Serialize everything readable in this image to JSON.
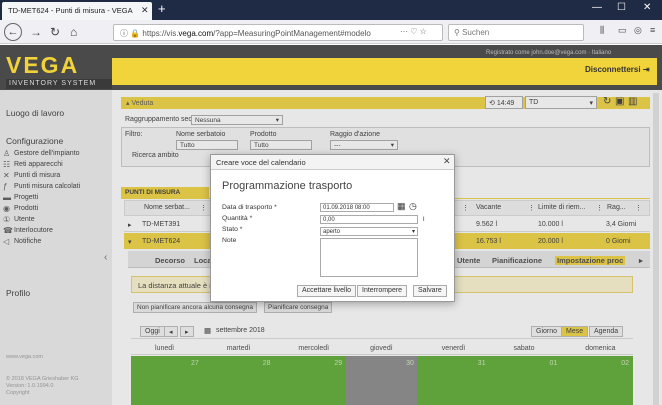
{
  "browser": {
    "tab_title": "TD-MET624 - Punti di misura - VEGA",
    "url_prefix": "https://vis.",
    "url_host": "vega.com",
    "url_rest": "/?app=MeasuringPointManagement#modelo",
    "search_placeholder": "Suchen"
  },
  "header": {
    "logo": "VEGA",
    "subtitle": "INVENTORY SYSTEM",
    "registered": "Registrato come john.doe@vega.com · Italiano",
    "logout": "Disconnettersi"
  },
  "sidebar": {
    "workplace": "Luogo di lavoro",
    "config": "Configurazione",
    "items": [
      {
        "label": "Gestore dell'impianto",
        "icon": "plant-icon"
      },
      {
        "label": "Reti apparecchi",
        "icon": "network-icon"
      },
      {
        "label": "Punti di misura",
        "icon": "tools-icon"
      },
      {
        "label": "Punti misura calcolati",
        "icon": "function-icon"
      },
      {
        "label": "Progetti",
        "icon": "folder-icon"
      },
      {
        "label": "Prodotti",
        "icon": "product-icon"
      },
      {
        "label": "Utente",
        "icon": "user-icon"
      },
      {
        "label": "Interlocutore",
        "icon": "phone-icon"
      },
      {
        "label": "Notifiche",
        "icon": "megaphone-icon"
      }
    ],
    "profile": "Profilo",
    "footer1": "www.vega.com",
    "footer2": "© 2018 VEGA Grieshaber KG",
    "footer3": "Version: 1.0.1994.0",
    "footer4": "Copyright"
  },
  "view": {
    "veduta": "Veduta",
    "time": "14:49",
    "td": "TD",
    "group_label": "Raggruppamento secondo:",
    "group_value": "Nessuna",
    "filter": "Filtro:",
    "f1": "Nome serbatoio",
    "f1v": "Tutto",
    "f2": "Prodotto",
    "f2v": "Tutto",
    "f3": "Raggio d'azione",
    "f3v": "---",
    "search": "Ricerca ambito"
  },
  "table": {
    "title": "PUNTI DI MISURA",
    "headers": [
      "Nome serbat...",
      "Vacante",
      "Limite di riem...",
      "Rag..."
    ],
    "rows": [
      {
        "name": "TD-MET391",
        "vacante": "9.562 l",
        "limite": "10.000 l",
        "rag": "3,4 Giorni"
      },
      {
        "name": "TD-MET624",
        "vacante": "16.753 l",
        "limite": "20.000 l",
        "rag": "0 Giorni"
      }
    ]
  },
  "tabs": [
    "Decorso",
    "Locat",
    "Utente",
    "Pianificazione",
    "Impostazione proc"
  ],
  "distance": "La distanza attuale è m",
  "plan": {
    "b1": "Non pianificare ancora alcuna consegna",
    "b2": "Pianificare consegna"
  },
  "calendar": {
    "today": "Oggi",
    "month": "settembre 2018",
    "views": [
      "Giorno",
      "Mese",
      "Agenda"
    ],
    "days": [
      "lunedì",
      "martedì",
      "mercoledì",
      "giovedì",
      "venerdì",
      "sabato",
      "domenica"
    ],
    "nums": [
      "27",
      "28",
      "29",
      "30",
      "31",
      "01",
      "02"
    ]
  },
  "modal": {
    "header": "Creare voce del calendario",
    "title": "Programmazione trasporto",
    "l_date": "Data di trasporto *",
    "v_date": "01.09.2018 08:00",
    "l_qty": "Quantità *",
    "v_qty": "0,00",
    "unit": "l",
    "l_state": "Stato *",
    "v_state": "aperto",
    "l_note": "Note",
    "b_accept": "Accettare livello",
    "b_stop": "Interrompere",
    "b_save": "Salvare"
  }
}
